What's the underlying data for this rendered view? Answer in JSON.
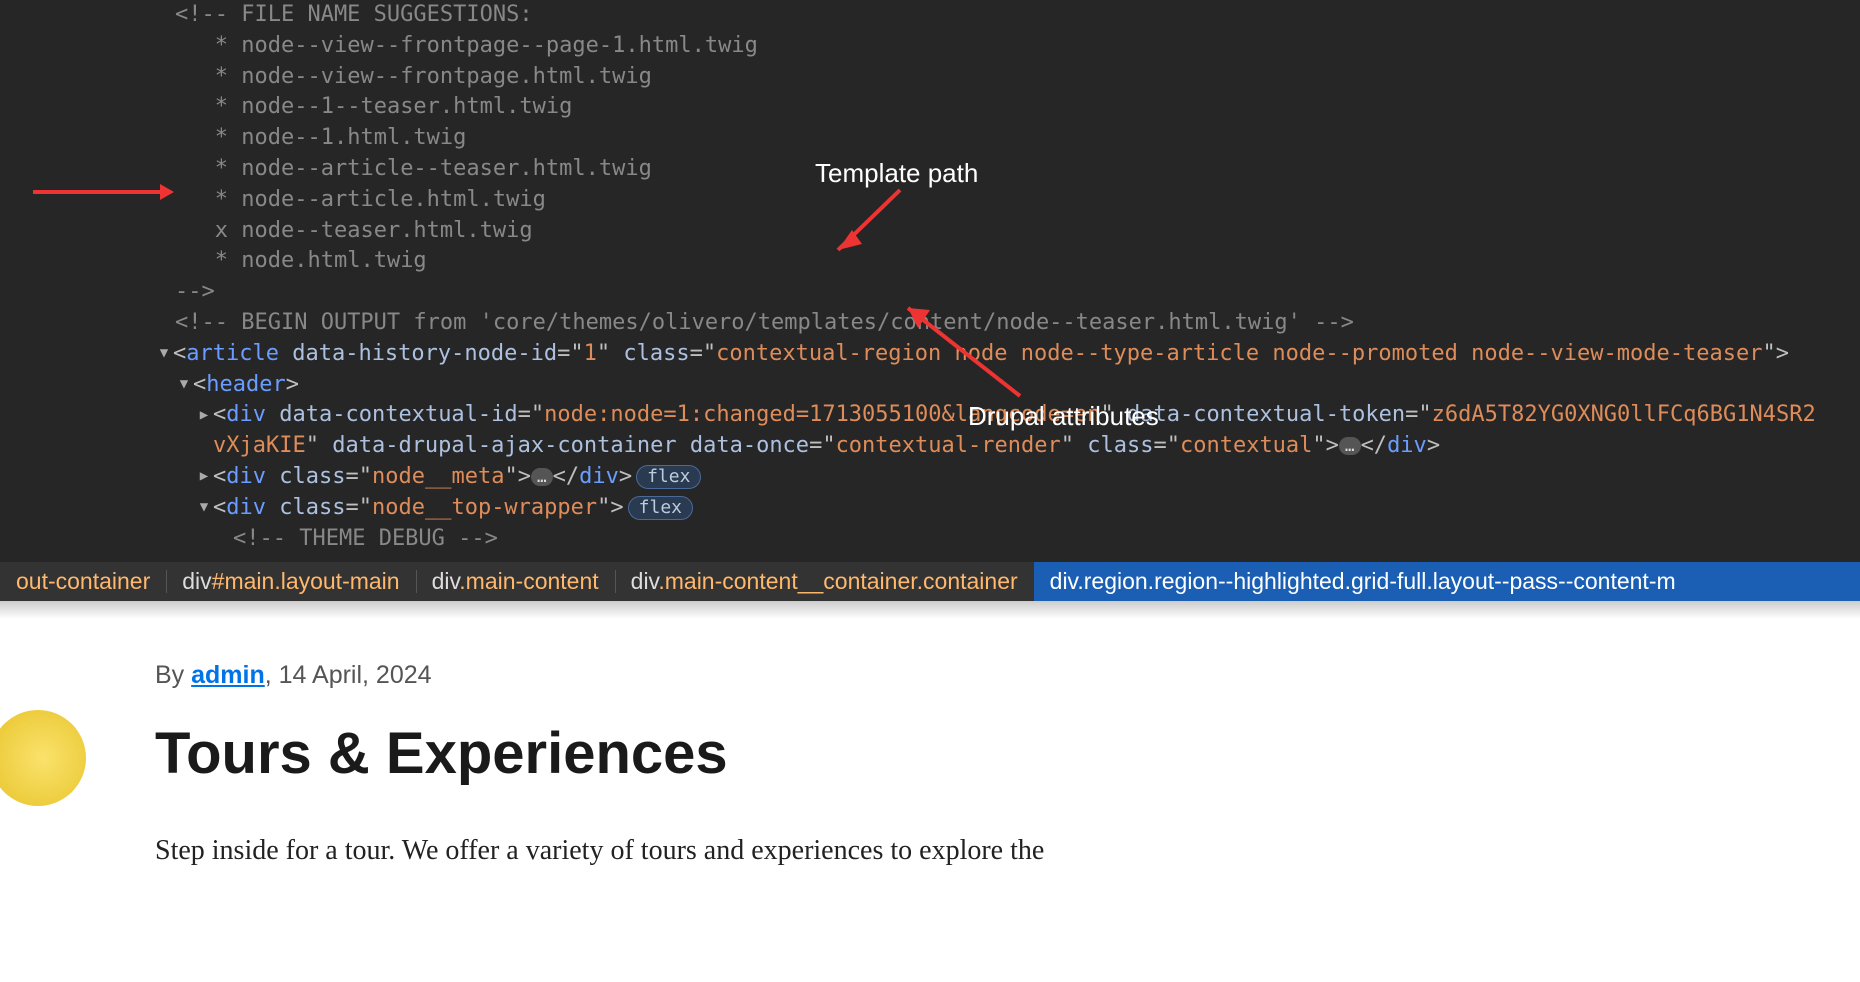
{
  "code": {
    "indent": "   ",
    "file_name_suggestions_label": "<!-- FILE NAME SUGGESTIONS:",
    "suggestions": [
      {
        "mark": "*",
        "name": "node--view--frontpage--page-1.html.twig"
      },
      {
        "mark": "*",
        "name": "node--view--frontpage.html.twig"
      },
      {
        "mark": "*",
        "name": "node--1--teaser.html.twig"
      },
      {
        "mark": "*",
        "name": "node--1.html.twig"
      },
      {
        "mark": "*",
        "name": "node--article--teaser.html.twig"
      },
      {
        "mark": "*",
        "name": "node--article.html.twig"
      },
      {
        "mark": "x",
        "name": "node--teaser.html.twig"
      },
      {
        "mark": "*",
        "name": "node.html.twig"
      }
    ],
    "end_suggestions": "-->",
    "begin_output_prefix": "<!-- BEGIN OUTPUT from '",
    "begin_output_path": "core/themes/olivero/templates/content/node--teaser.html.twig",
    "begin_output_suffix": "' -->",
    "article": {
      "tag": "article",
      "attr1_name": "data-history-node-id",
      "attr1_value": "1",
      "attr2_name": "class",
      "attr2_value": "contextual-region node node--type-article node--promoted node--view-mode-teaser"
    },
    "header_tag": "header",
    "contextual_div": {
      "attr1_name": "data-contextual-id",
      "attr1_value": "node:node=1:changed=1713055100&langcode=en",
      "attr2_name": "data-contextual-token",
      "attr2_value_line1": "z6dA5T82YG0XNG0llFCq6BG1N4SR2",
      "attr2_value_line2": "vXjaKIE",
      "attr3_name": "data-drupal-ajax-container",
      "attr4_name": "data-once",
      "attr4_value": "contextual-render",
      "attr5_name": "class",
      "attr5_value": "contextual"
    },
    "meta_div_class": "node__meta",
    "top_wrapper_class": "node__top-wrapper",
    "theme_debug_comment": "<!-- THEME DEBUG -->",
    "flex_badge": "flex",
    "ellipsis": "…"
  },
  "annotations": {
    "template_path": "Template path",
    "drupal_attributes": "Drupal attributes"
  },
  "breadcrumb": {
    "item0": {
      "tag": "",
      "cls": "out-container"
    },
    "item1": {
      "tag": "div",
      "id": "#main",
      "cls": ".layout-main"
    },
    "item2": {
      "tag": "div",
      "cls": ".main-content"
    },
    "item3": {
      "tag": "div",
      "cls": ".main-content__container.container"
    },
    "item4": {
      "tag": "div",
      "cls": ".region.region--highlighted.grid-full.layout--pass--content-m"
    }
  },
  "page": {
    "by_prefix": "By ",
    "author": "admin",
    "date_suffix": ", 14 April, 2024",
    "title": "Tours & Experiences",
    "body": "Step inside for a tour. We offer a variety of tours and experiences to explore the"
  }
}
